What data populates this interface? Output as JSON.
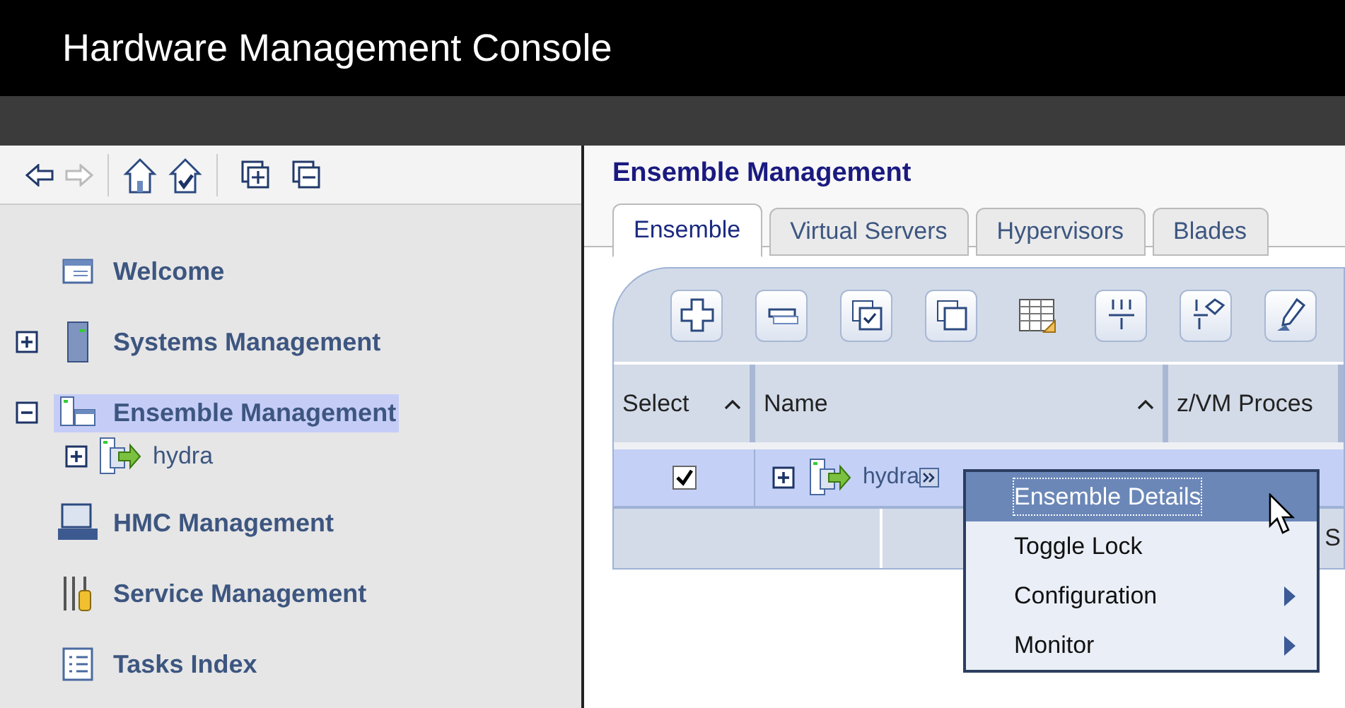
{
  "window": {
    "title": "Hardware Management Console"
  },
  "nav_tree": [
    {
      "label": "Welcome",
      "selected": false
    },
    {
      "label": "Systems Management",
      "selected": false,
      "expanded": false
    },
    {
      "label": "Ensemble Management",
      "selected": true,
      "expanded": true,
      "children": [
        {
          "label": "hydra",
          "selected": false,
          "expanded": false
        }
      ]
    },
    {
      "label": "HMC Management",
      "selected": false
    },
    {
      "label": "Service Management",
      "selected": false
    },
    {
      "label": "Tasks Index",
      "selected": false
    }
  ],
  "content": {
    "heading": "Ensemble Management",
    "tabs": [
      {
        "label": "Ensemble",
        "selected": true
      },
      {
        "label": "Virtual Servers",
        "selected": false
      },
      {
        "label": "Hypervisors",
        "selected": false
      },
      {
        "label": "Blades",
        "selected": false
      }
    ],
    "table": {
      "columns": [
        {
          "label": "Select",
          "sortable": true
        },
        {
          "label": "Name",
          "sortable": true
        },
        {
          "label": "z/VM Proces",
          "sortable": false
        }
      ],
      "rows": [
        {
          "checked": true,
          "selected": true,
          "name": "hydra",
          "expanded": false
        }
      ],
      "footer_text": "S"
    },
    "context_menu": [
      {
        "label": "Ensemble Details",
        "selected": true,
        "submenu": false
      },
      {
        "label": "Toggle Lock",
        "selected": false,
        "submenu": false
      },
      {
        "label": "Configuration",
        "selected": false,
        "submenu": true
      },
      {
        "label": "Monitor",
        "selected": false,
        "submenu": true
      }
    ]
  }
}
